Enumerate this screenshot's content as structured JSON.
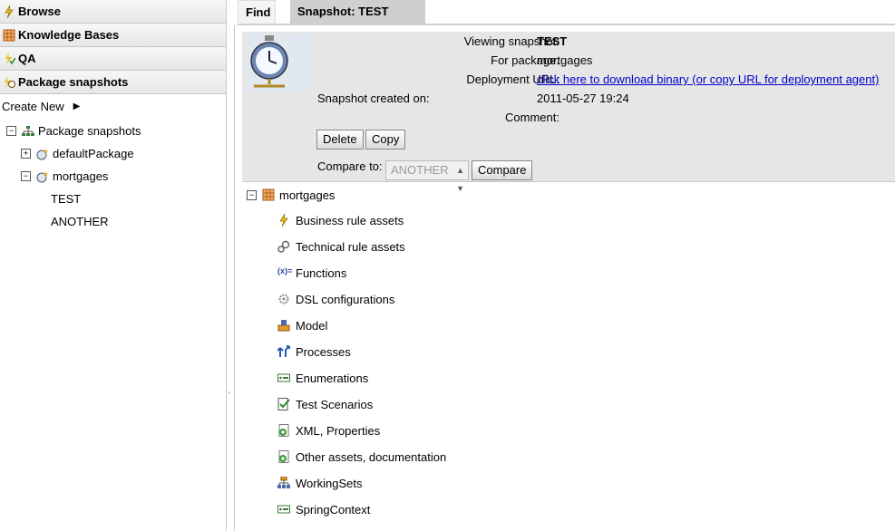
{
  "nav": {
    "items": [
      {
        "label": "Browse",
        "icon": "lightning-icon"
      },
      {
        "label": "Knowledge Bases",
        "icon": "package-icon"
      },
      {
        "label": "QA",
        "icon": "qa-icon"
      },
      {
        "label": "Package snapshots",
        "icon": "snapshot-icon"
      }
    ],
    "create_new": "Create New"
  },
  "tree": {
    "root": "Package snapshots",
    "packages": [
      "defaultPackage",
      "mortgages"
    ],
    "snapshots": [
      "TEST",
      "ANOTHER"
    ]
  },
  "tabs": {
    "find": "Find",
    "snapshot": "Snapshot: TEST"
  },
  "snapshot": {
    "viewing_label": "Viewing snapshot:",
    "viewing_value": "TEST",
    "package_label": "For package:",
    "package_value": "mortgages",
    "deploy_label": "Deployment URL:",
    "deploy_link": "click here to download binary (or copy URL for deployment agent)",
    "created_label": "Snapshot created on:",
    "created_value": "2011-05-27 19:24",
    "comment_label": "Comment:",
    "delete": "Delete",
    "copy": "Copy",
    "compare_label": "Compare to:",
    "compare_select": "ANOTHER",
    "compare_button": "Compare"
  },
  "assets": {
    "package": "mortgages",
    "items": [
      "Business rule assets",
      "Technical rule assets",
      "Functions",
      "DSL configurations",
      "Model",
      "Processes",
      "Enumerations",
      "Test Scenarios",
      "XML, Properties",
      "Other assets, documentation",
      "WorkingSets",
      "SpringContext"
    ]
  },
  "colors": {
    "link": "#0000cc",
    "panel": "#e6e6e6",
    "tab_active": "#cfcfcf"
  }
}
